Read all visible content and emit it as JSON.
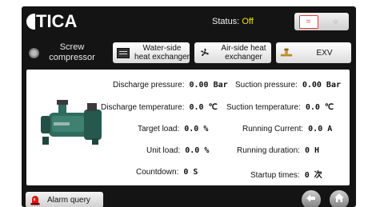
{
  "header": {
    "logo_text": "TICA",
    "status_label": "Status:",
    "status_value": "Off",
    "toggle_on": "=",
    "toggle_off": "○"
  },
  "tabs": {
    "screw": "Screw compressor",
    "water_hx": "Water-side heat exchanger",
    "air_hx": "Air-side heat exchanger",
    "exv": "EXV"
  },
  "params": [
    {
      "label": "Discharge pressure:",
      "value": "0.00 Bar"
    },
    {
      "label": "Suction pressure:",
      "value": "0.00 Bar"
    },
    {
      "label": "Discharge temperature:",
      "value": "0.0 ℃"
    },
    {
      "label": "Suction temperature:",
      "value": "0.0 ℃"
    },
    {
      "label": "Target load:",
      "value": "0.0 %"
    },
    {
      "label": "Running Current:",
      "value": "0.0 A"
    },
    {
      "label": "Unit load:",
      "value": "0.0 %"
    },
    {
      "label": "Running duration:",
      "value": "0 H"
    },
    {
      "label": "Countdown:",
      "value": "0 S"
    },
    {
      "label": "Startup times:",
      "value": "0 次"
    }
  ],
  "footer": {
    "alarm_label": "Alarm query"
  },
  "colors": {
    "status_off": "#f5e400",
    "background": "#141414"
  }
}
